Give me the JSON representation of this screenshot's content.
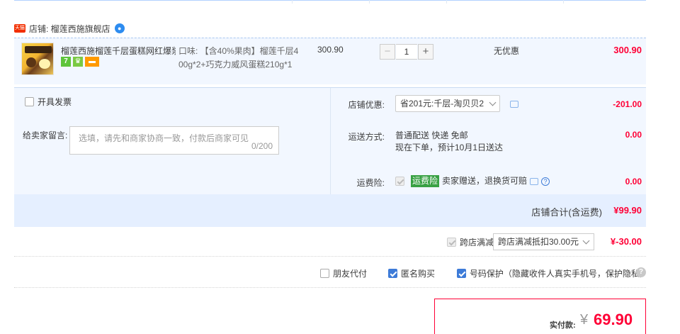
{
  "shop": {
    "tag": "天猫",
    "name_label": "店铺: 榴莲西施旗舰店"
  },
  "item": {
    "title": "榴莲西施榴莲千层蛋糕网红爆浆...",
    "sku_line1": "口味: 【含40%果肉】榴莲千层4",
    "sku_line2": "00g*2+巧克力威风蛋糕210g*1",
    "unit_price": "300.90",
    "quantity": "1",
    "minus": "−",
    "plus": "+",
    "discount": "无优惠",
    "subtotal": "300.90",
    "badges": [
      "7",
      "crown-icon",
      "card-icon"
    ]
  },
  "options": {
    "invoice_label": "开具发票",
    "message_label": "给卖家留言:",
    "message_placeholder": "选填，请先和商家协商一致，付款后商家可见",
    "message_count": "0/200",
    "shop_discount_label": "店铺优惠:",
    "shop_discount_value": "省201元:千层-淘贝贝2",
    "shop_discount_amount": "-201.00",
    "shipping_label": "运送方式:",
    "shipping_line1": "普通配送 快递 免邮",
    "shipping_line2": "现在下单，预计10月1日送达",
    "shipping_amount": "0.00",
    "insurance_label": "运费险:",
    "insurance_tag": "运费险",
    "insurance_text": "卖家赠送，退换货可赔",
    "insurance_amount": "0.00",
    "shop_total_label": "店铺合计(含运费)",
    "shop_total_value": "¥99.90"
  },
  "cross_store": {
    "label": "跨店满减",
    "select_value": "跨店满减抵扣30.00元",
    "amount": "¥-30.00"
  },
  "checkout_options": {
    "friend_pay": "朋友代付",
    "anonymous": "匿名购买",
    "number_protect": "号码保护（隐藏收件人真实手机号，保护隐私）"
  },
  "payment": {
    "label": "实付款:",
    "currency": "¥",
    "amount": "69.90"
  },
  "colors": {
    "accent_red": "#ff0036",
    "panel_blue": "#f2f7ff",
    "checkbox_blue": "#3d7bd8"
  }
}
